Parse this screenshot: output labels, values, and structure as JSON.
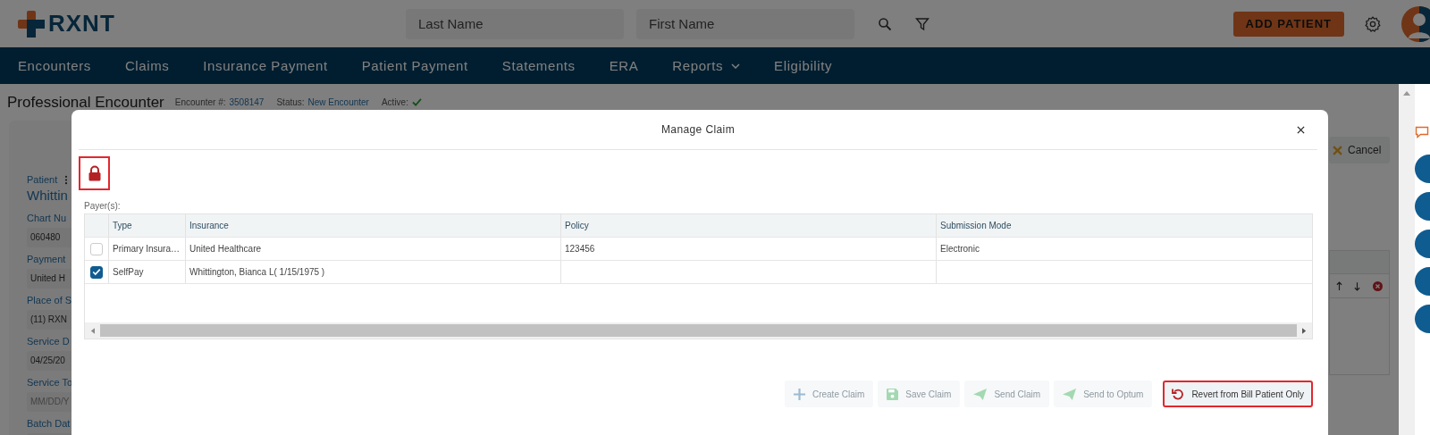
{
  "header": {
    "logo": "RXNT",
    "last_name": {
      "placeholder": "Last Name"
    },
    "first_name": {
      "placeholder": "First Name"
    },
    "add_button": "ADD PATIENT"
  },
  "nav": [
    {
      "label": "Encounters",
      "dropdown": false
    },
    {
      "label": "Claims",
      "dropdown": false
    },
    {
      "label": "Insurance Payment",
      "dropdown": false
    },
    {
      "label": "Patient Payment",
      "dropdown": false
    },
    {
      "label": "Statements",
      "dropdown": false
    },
    {
      "label": "ERA",
      "dropdown": false
    },
    {
      "label": "Reports",
      "dropdown": true
    },
    {
      "label": "Eligibility",
      "dropdown": false
    }
  ],
  "page": {
    "title": "Professional Encounter",
    "meta": [
      {
        "label": "Encounter #:",
        "value": "3508147"
      },
      {
        "label": "Status:",
        "value": "New Encounter"
      }
    ],
    "active_label": "Active:",
    "active": true
  },
  "patient_panel": {
    "label": "Patient",
    "name": "Whittin",
    "fields": [
      {
        "label": "Chart Nu",
        "value": "060480"
      },
      {
        "label": "Payment",
        "value": "United H"
      },
      {
        "label": "Place of S",
        "value": "(11) RXN"
      },
      {
        "label": "Service D",
        "value": "04/25/20"
      },
      {
        "label": "Service To",
        "placeholder": "MM/DD/Y"
      },
      {
        "label": "Batch Dat"
      }
    ]
  },
  "cancel_button": "Cancel",
  "modal": {
    "title": "Manage Claim",
    "locked": true,
    "lock_highlighted": true,
    "payers_label": "Payer(s):",
    "columns": [
      "Type",
      "Insurance",
      "Policy",
      "Submission Mode"
    ],
    "rows": [
      {
        "selected": false,
        "type": "Primary Insura…",
        "insurance": "United Healthcare",
        "policy": "123456",
        "submission_mode": "Electronic"
      },
      {
        "selected": true,
        "type": "SelfPay",
        "insurance": "Whittington, Bianca L( 1/15/1975 )"
      }
    ],
    "actions": [
      {
        "label": "Create Claim",
        "kind": "plus",
        "disabled": true,
        "highlighted": false
      },
      {
        "label": "Save Claim",
        "kind": "save",
        "disabled": true,
        "highlighted": false
      },
      {
        "label": "Send Claim",
        "kind": "send",
        "disabled": true,
        "highlighted": false
      },
      {
        "label": "Send to Optum",
        "kind": "send",
        "disabled": true,
        "highlighted": false
      },
      {
        "label": "Revert from Bill Patient Only",
        "kind": "undo",
        "disabled": false,
        "highlighted": true
      }
    ]
  }
}
